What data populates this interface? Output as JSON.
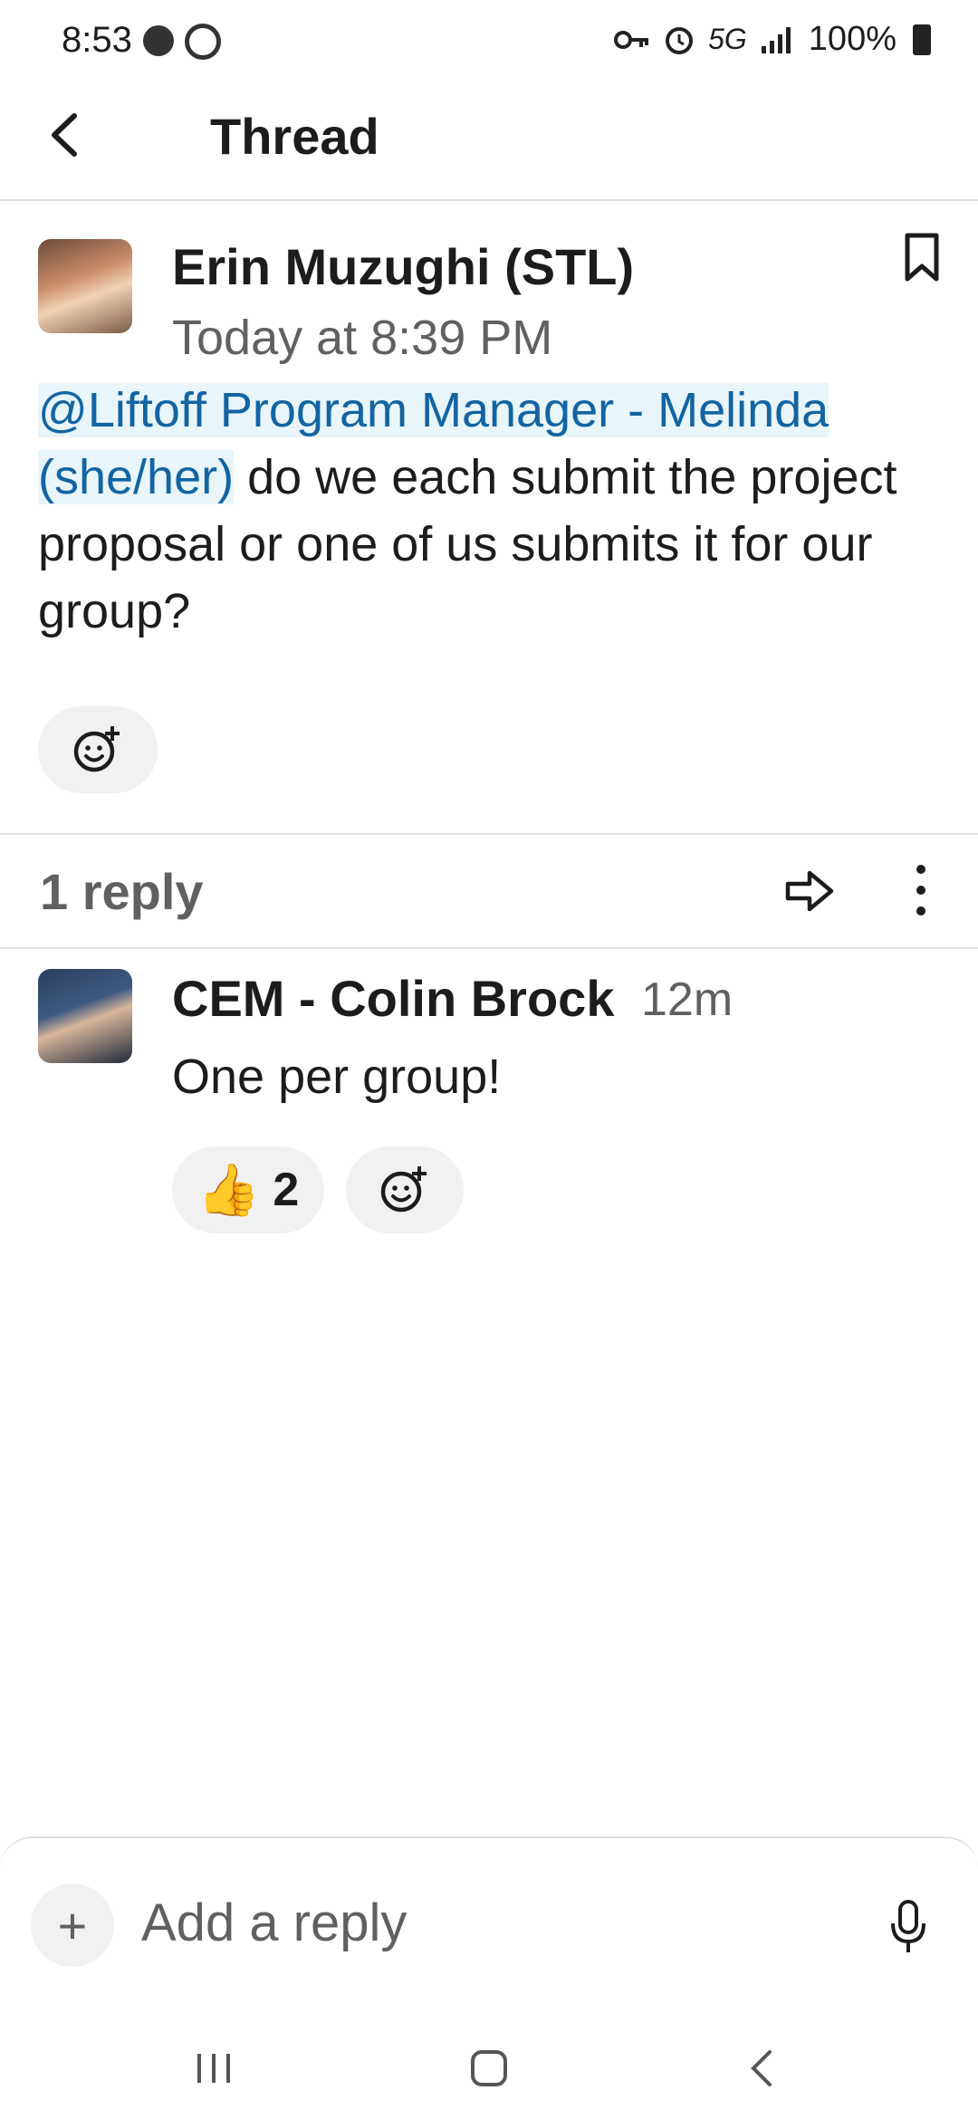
{
  "status_bar": {
    "time": "8:53",
    "network": "5G",
    "battery": "100%",
    "icons": [
      "messenger-icon",
      "circle-icon",
      "key-icon",
      "alarm-icon",
      "signal-icon",
      "battery-icon"
    ]
  },
  "header": {
    "title": "Thread"
  },
  "parent_message": {
    "author": "Erin Muzughi (STL)",
    "timestamp": "Today at 8:39 PM",
    "mention": "@Liftoff Program Manager - Melinda (she/her)",
    "text": " do we each submit the project proposal or one of us submits it for our group?"
  },
  "replies_bar": {
    "count_label": "1 reply"
  },
  "reply": {
    "author": "CEM - Colin Brock",
    "timestamp": "12m",
    "text": "One per group!",
    "reactions": [
      {
        "emoji": "👍",
        "count": "2"
      }
    ]
  },
  "composer": {
    "placeholder": "Add a reply"
  },
  "colors": {
    "mention": "#1264a3",
    "mention_bg": "#e8f5fa",
    "muted": "#616061"
  }
}
